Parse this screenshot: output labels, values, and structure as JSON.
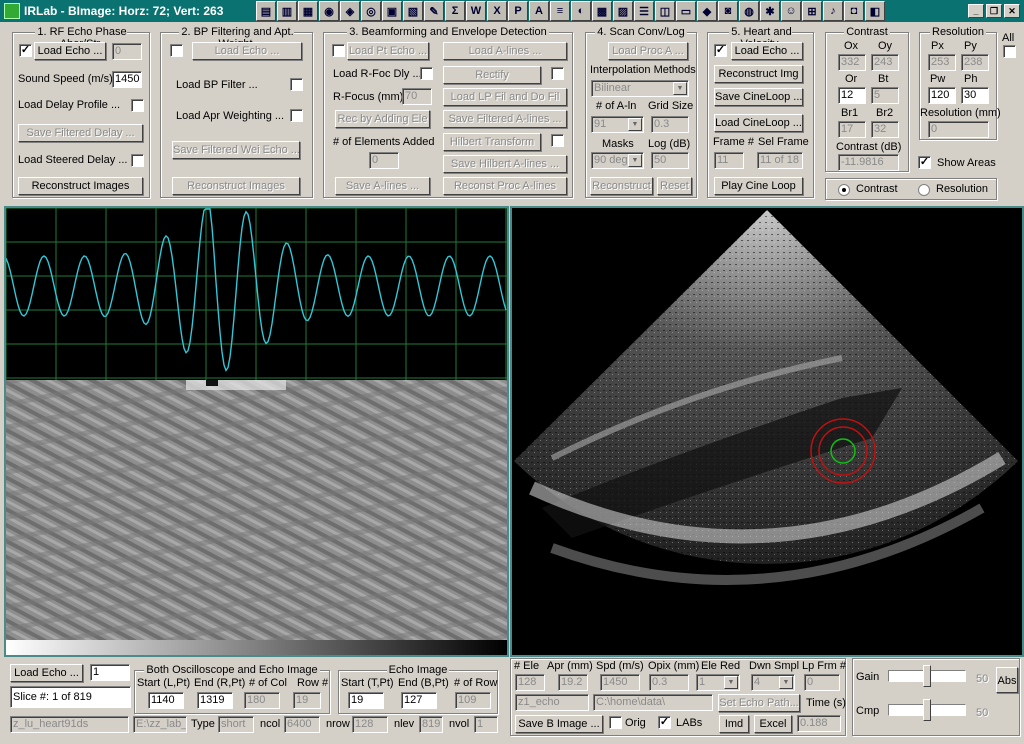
{
  "window": {
    "title": "IRLab - BImage: Horz: 72; Vert: 263"
  },
  "toolbar_icons": [
    "new-doc-icon",
    "folder-icon",
    "open-icon",
    "globe-icon",
    "save-icon",
    "print-icon",
    "pdf-icon",
    "pdf2-icon",
    "edit-icon",
    "sum-icon",
    "word-icon",
    "excel-icon",
    "powerpoint-icon",
    "access-icon",
    "stack-icon",
    "eye-icon",
    "file-icon",
    "doc-icon",
    "list-icon",
    "app-icon",
    "monitor-icon",
    "image-icon",
    "camera-icon",
    "globe2-icon",
    "gear-icon",
    "user-icon",
    "grid-icon",
    "music-icon",
    "disk-icon",
    "print2-icon"
  ],
  "sec1": {
    "title": "1. RF Echo Phase Aber/Str",
    "load_echo": "Load Echo ...",
    "load_echo_value": "0",
    "sound_speed_label": "Sound Speed (m/s)",
    "sound_speed": "1450",
    "load_delay": "Load Delay Profile ...",
    "save_filtered": "Save Filtered Delay ...",
    "load_steered": "Load Steered Delay ...",
    "reconstruct": "Reconstruct Images"
  },
  "sec2": {
    "title": "2. BP Filtering and Apt. Weight",
    "load_echo": "Load Echo ...",
    "load_bp": "Load BP Filter ...",
    "load_apr": "Load Apr Weighting ...",
    "save_filtered": "Save Filtered Wei Echo ...",
    "reconstruct": "Reconstruct Images"
  },
  "sec3": {
    "title": "3. Beamforming and Envelope Detection",
    "load_pt": "Load Pt Echo ...",
    "load_alines": "Load A-lines ...",
    "load_rfoc": "Load R-Foc Dly ...",
    "rectify": "Rectify",
    "rfocus_label": "R-Focus (mm)",
    "rfocus": "70",
    "load_lp": "Load LP Fil and Do Fil",
    "rec_adding": "Rec by Adding Ele",
    "save_filt_alines": "Save Filtered A-lines ...",
    "n_elements_label": "# of Elements Added",
    "hilbert": "Hilbert Transform",
    "n_elements": "0",
    "save_hilbert": "Save Hilbert A-lines ...",
    "save_alines": "Save A-lines ...",
    "reconst_proc": "Reconst Proc A-lines"
  },
  "sec4": {
    "title": "4. Scan Conv/Log",
    "load_proc": "Load Proc A ...",
    "interp_label": "Interpolation Methods",
    "interp": "Bilinear",
    "n_aln_label": "# of A-ln",
    "grid_label": "Grid Size",
    "n_aln": "91",
    "grid": "0.3",
    "masks_label": "Masks",
    "log_label": "Log (dB)",
    "masks": "90 deg",
    "log": "50",
    "reconstruct": "Reconstruct",
    "reset": "Reset"
  },
  "sec5": {
    "title": "5. Heart and Velocity",
    "load_echo": "Load Echo ...",
    "reconstruct": "Reconstruct Img",
    "save_cine": "Save CineLoop ...",
    "load_cine": "Load CineLoop ...",
    "frame_label": "Frame #",
    "sel_frame_label": "Sel Frame",
    "frame": "11",
    "sel_frame": "11 of 18",
    "play": "Play Cine Loop"
  },
  "contrast": {
    "title": "Contrast",
    "ox_label": "Ox",
    "oy_label": "Oy",
    "ox": "332",
    "oy": "243",
    "or_label": "Or",
    "bt_label": "Bt",
    "or": "12",
    "bt": "5",
    "br1_label": "Br1",
    "br2_label": "Br2",
    "br1": "17",
    "br2": "32",
    "cdb_label": "Contrast (dB)",
    "cdb": "-11.9816"
  },
  "resolution": {
    "title": "Resolution",
    "px_label": "Px",
    "py_label": "Py",
    "px": "253",
    "py": "238",
    "pw_label": "Pw",
    "ph_label": "Ph",
    "pw": "120",
    "ph": "30",
    "res_label": "Resolution (mm)",
    "res": "0"
  },
  "all_label": "All",
  "show_areas": "Show Areas",
  "radio_contrast": "Contrast",
  "radio_resolution": "Resolution",
  "bottom": {
    "load_echo": "Load Echo ...",
    "load_echo_value": "1",
    "slice": "Slice #: 1 of 819",
    "file_name": "z_lu_heart91ds",
    "file_path": "E:\\zz_lab_",
    "type_label": "Type",
    "type": "short",
    "ncol_label": "ncol",
    "ncol": "6400",
    "nrow_label": "nrow",
    "nrow": "128",
    "nlev_label": "nlev",
    "nlev": "819",
    "nvol_label": "nvol",
    "nvol": "1",
    "osc_title": "Both Oscilloscope and Echo Image",
    "start_label": "Start (L,Pt)",
    "end_label": "End (R,Pt)",
    "ncol2_label": "# of Col",
    "row_label": "Row #",
    "start": "1140",
    "end": "1319",
    "ncol2": "180",
    "row": "19",
    "echo_title": "Echo Image",
    "tstart_label": "Start (T,Pt)",
    "bend_label": "End (B,Pt)",
    "nrow2_label": "# of Row",
    "tstart": "19",
    "bend": "127",
    "nrow2": "109"
  },
  "params": {
    "ele_label": "# Ele",
    "apr_label": "Apr (mm)",
    "spd_label": "Spd (m/s)",
    "opix_label": "Opix (mm)",
    "elered_label": "Ele Red",
    "dwn_label": "Dwn Smpl",
    "lpfrm_label": "Lp Frm #",
    "ele": "128",
    "apr": "19.2",
    "spd": "1450",
    "opix": "0.3",
    "elered": "1",
    "dwn": "4",
    "lpfrm": "0",
    "fname": "z1_echo",
    "fpath": "C:\\home\\data\\",
    "set_path": "Set Echo Path...",
    "time_label": "Time (s)",
    "save_b": "Save B Image ...",
    "orig": "Orig",
    "labs": "LABs",
    "imd": "Imd",
    "excel": "Excel",
    "time": "0.188"
  },
  "gain": {
    "gain_label": "Gain",
    "gain": "50",
    "cmp_label": "Cmp",
    "cmp": "50",
    "abs": "Abs"
  },
  "colors": {
    "teal": "#0a7270",
    "trace": "#33c6d6",
    "roi_outer": "#c01010",
    "roi_inner": "#10c010"
  }
}
